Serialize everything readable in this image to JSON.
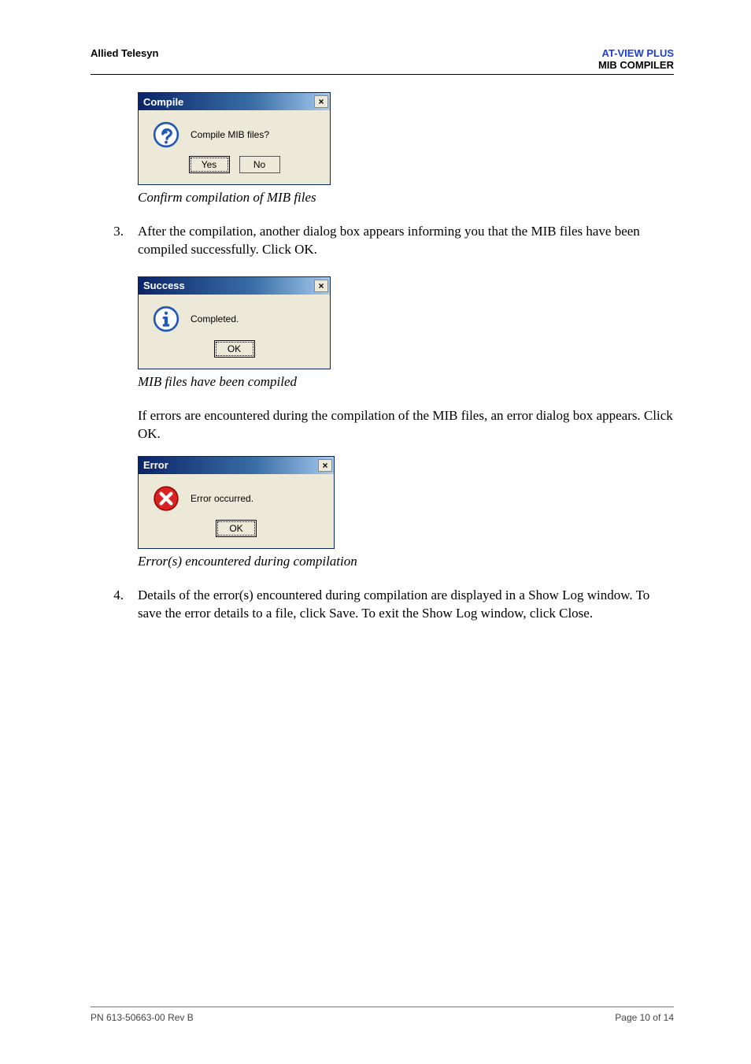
{
  "header": {
    "left": "Allied Telesyn",
    "right_blue": "AT-VIEW PLUS",
    "right_black": "MIB COMPILER"
  },
  "dialogs": {
    "compile": {
      "title": "Compile",
      "message": "Compile MIB files?",
      "yes": "Yes",
      "no": "No",
      "close": "×"
    },
    "success": {
      "title": "Success",
      "message": "Completed.",
      "ok": "OK",
      "close": "×"
    },
    "error": {
      "title": "Error",
      "message": "Error occurred.",
      "ok": "OK",
      "close": "×"
    }
  },
  "captions": {
    "compile": "Confirm compilation of MIB files",
    "success": "MIB files have been compiled",
    "error": "Error(s) encountered during compilation"
  },
  "body": {
    "step3_num": "3.",
    "step3": "After the compilation, another dialog box appears informing you that the MIB files have been compiled successfully. Click OK.",
    "para_error": "If errors are encountered during the compilation of the MIB files, an error dialog box appears. Click OK.",
    "step4_num": "4.",
    "step4": "Details of the error(s) encountered during compilation are displayed in a Show Log window. To save the error details to a file, click Save. To exit the Show Log window, click Close."
  },
  "footer": {
    "left": "PN 613-50663-00 Rev B",
    "right": "Page 10 of 14"
  }
}
